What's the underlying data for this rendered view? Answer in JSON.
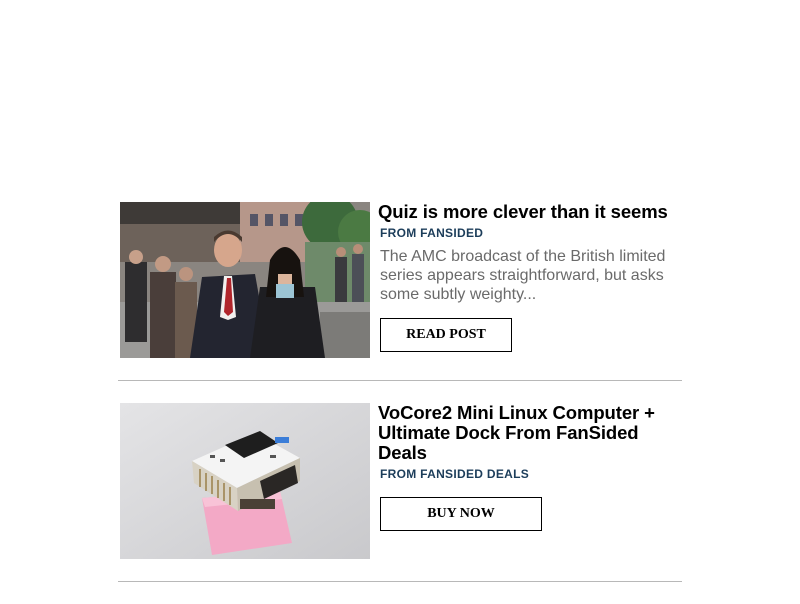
{
  "feed": {
    "items": [
      {
        "title": "Quiz is more clever than it seems",
        "source": "FROM FANSIDED",
        "description": "The AMC broadcast of the British limited series appears straightforward, but asks some subtly weighty...",
        "button_label": "READ POST",
        "image_icon": "news-photo"
      },
      {
        "title": "VoCore2 Mini Linux Computer + Ultimate Dock From FanSided Deals",
        "source": "FROM FANSIDED DEALS",
        "description": "",
        "button_label": "BUY NOW",
        "image_icon": "product-photo"
      }
    ]
  },
  "colors": {
    "source_text": "#1c3d5a",
    "description_text": "#6a6a6a",
    "divider": "#b8b8b8"
  }
}
